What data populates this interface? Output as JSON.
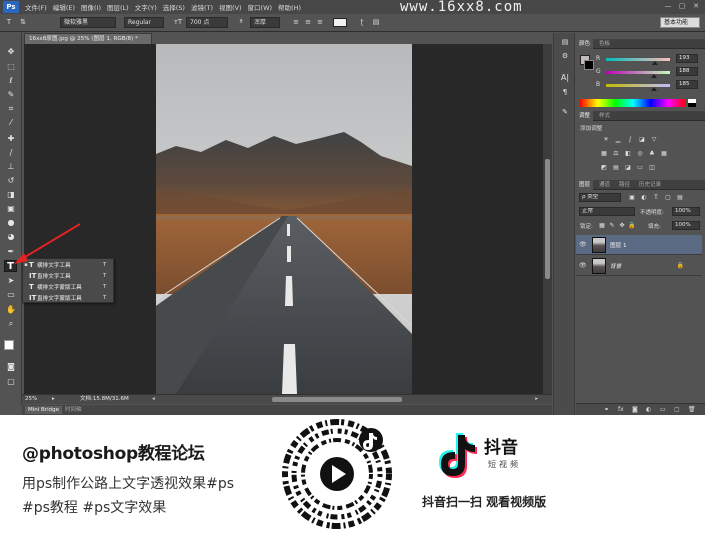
{
  "app": {
    "logo": "Ps",
    "menu": [
      "文件(F)",
      "编辑(E)",
      "图像(I)",
      "图层(L)",
      "文字(Y)",
      "选择(S)",
      "滤镜(T)",
      "视图(V)",
      "窗口(W)",
      "帮助(H)"
    ],
    "watermark": "www.16xx8.com",
    "window_controls": [
      "—",
      "▢",
      "✕"
    ]
  },
  "options_bar": {
    "font_family": "微软雅黑",
    "font_style": "Regular",
    "font_size": "700 点",
    "antialias": "浑厚",
    "workspace": "基本功能"
  },
  "document": {
    "tab_title": "16xx8原图.jpg @ 25% (图层 1, RGB/8) *",
    "zoom": "25%",
    "doc_size": "文档:15.8M/31.6M",
    "bottom_tabs": [
      "Mini Bridge",
      "时间轴"
    ]
  },
  "type_tool_menu": {
    "items": [
      {
        "label": "横排文字工具",
        "key": "T",
        "selected": true
      },
      {
        "label": "直排文字工具",
        "key": "T",
        "selected": false
      },
      {
        "label": "横排文字蒙版工具",
        "key": "T",
        "selected": false
      },
      {
        "label": "直排文字蒙版工具",
        "key": "T",
        "selected": false
      }
    ]
  },
  "color_panel": {
    "tabs": [
      "颜色",
      "色板"
    ],
    "r": "193",
    "g": "188",
    "b": "185"
  },
  "adjustments_panel": {
    "tabs": [
      "调整",
      "样式"
    ],
    "title": "添加调整"
  },
  "layers_panel": {
    "tabs": [
      "图层",
      "通道",
      "路径",
      "历史记录"
    ],
    "filter_kind": "ρ 类型",
    "blend_mode": "正常",
    "opacity_label": "不透明度:",
    "opacity": "100%",
    "lock_label": "锁定:",
    "fill_label": "填充:",
    "fill": "100%",
    "layers": [
      {
        "name": "图层 1",
        "selected": true
      },
      {
        "name": "背景",
        "selected": false
      }
    ]
  },
  "promo": {
    "account": "@photoshop教程论坛",
    "desc_line1": "用ps制作公路上文字透视效果#ps",
    "desc_line2": "#ps教程 #ps文字效果",
    "platform_name": "抖音",
    "platform_sub": "短视频",
    "scan_text": "抖音扫一扫 观看视频版"
  },
  "colors": {
    "ps_bg": "#535353",
    "menubar": "#474747",
    "canvas_bg": "#282828",
    "layer_selected": "#5a6a82",
    "arrow_red": "#e02424",
    "tiktok_cyan": "#25f4ee",
    "tiktok_red": "#fe2c55"
  },
  "icons": [
    "move-icon",
    "marquee-icon",
    "lasso-icon",
    "quick-select-icon",
    "crop-icon",
    "eyedropper-icon",
    "healing-icon",
    "brush-icon",
    "stamp-icon",
    "history-brush-icon",
    "eraser-icon",
    "gradient-icon",
    "blur-icon",
    "dodge-icon",
    "pen-icon",
    "type-icon",
    "path-select-icon",
    "shape-icon",
    "hand-icon",
    "zoom-icon",
    "eye-icon",
    "lock-icon",
    "play-icon",
    "tiktok-logo-icon"
  ]
}
